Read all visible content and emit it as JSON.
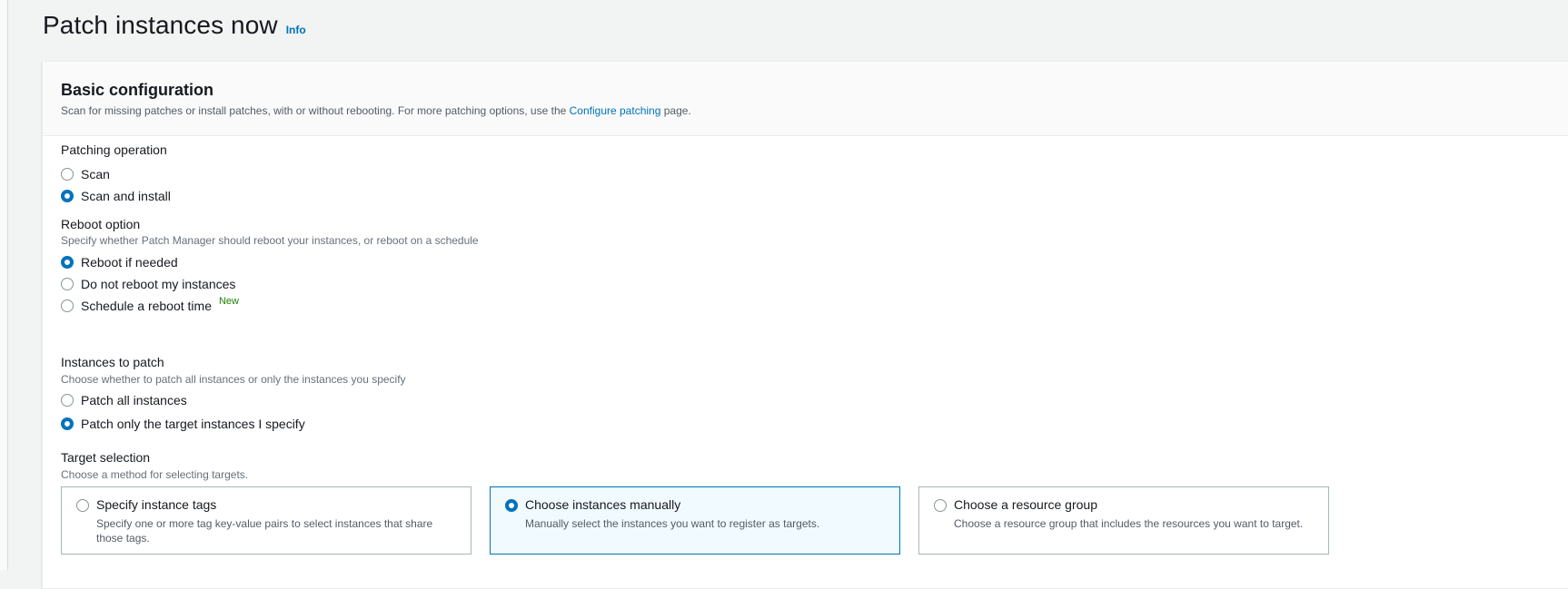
{
  "page": {
    "title": "Patch instances now",
    "info_link": "Info"
  },
  "panel": {
    "title": "Basic configuration",
    "desc_prefix": "Scan for missing patches or install patches, with or without rebooting. For more patching options, use the",
    "desc_link": "Configure patching",
    "desc_suffix": "page."
  },
  "patching_operation": {
    "label": "Patching operation",
    "options": [
      {
        "label": "Scan",
        "selected": false
      },
      {
        "label": "Scan and install",
        "selected": true
      }
    ]
  },
  "reboot_option": {
    "label": "Reboot option",
    "description": "Specify whether Patch Manager should reboot your instances, or reboot on a schedule",
    "options": [
      {
        "label": "Reboot if needed",
        "selected": true
      },
      {
        "label": "Do not reboot my instances",
        "selected": false
      },
      {
        "label": "Schedule a reboot time",
        "selected": false,
        "badge": "New"
      }
    ]
  },
  "instances_to_patch": {
    "label": "Instances to patch",
    "description": "Choose whether to patch all instances or only the instances you specify",
    "options": [
      {
        "label": "Patch all instances",
        "selected": false
      },
      {
        "label": "Patch only the target instances I specify",
        "selected": true
      }
    ]
  },
  "target_selection": {
    "label": "Target selection",
    "description": "Choose a method for selecting targets.",
    "tiles": [
      {
        "title": "Specify instance tags",
        "description": "Specify one or more tag key-value pairs to select instances that share those tags.",
        "selected": false
      },
      {
        "title": "Choose instances manually",
        "description": "Manually select the instances you want to register as targets.",
        "selected": true
      },
      {
        "title": "Choose a resource group",
        "description": "Choose a resource group that includes the resources you want to target.",
        "selected": false
      }
    ]
  },
  "colors": {
    "accent": "#0073bb",
    "new_badge": "#1d8102",
    "selected_tile_bg": "#f1faff"
  }
}
